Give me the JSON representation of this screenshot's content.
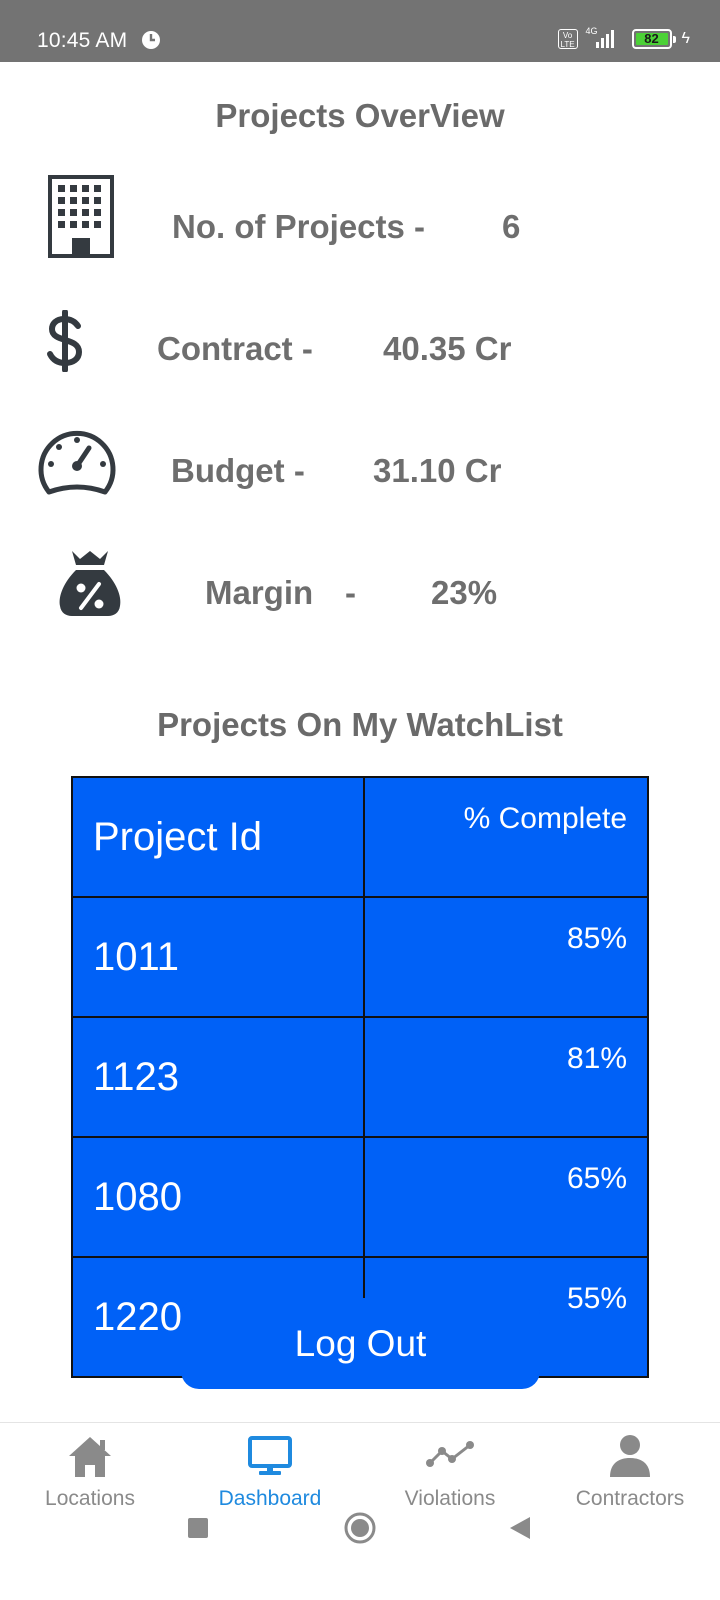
{
  "status_bar": {
    "time": "10:45 AM",
    "volte": "Vo LTE",
    "network": "4G",
    "battery": "82"
  },
  "overview": {
    "title": "Projects OverView",
    "rows": [
      {
        "label": "No. of Projects -",
        "value": "6",
        "icon": "building-icon"
      },
      {
        "label": "Contract -",
        "value": "40.35 Cr",
        "icon": "dollar-icon"
      },
      {
        "label": "Budget -",
        "value": "31.10 Cr",
        "icon": "speedometer-icon"
      },
      {
        "label": "Margin",
        "dash": "-",
        "value": "23%",
        "icon": "money-bag-percent-icon"
      }
    ]
  },
  "watchlist": {
    "title": "Projects On My WatchList",
    "header": {
      "project_id": "Project Id",
      "complete": "% Complete"
    },
    "rows": [
      {
        "id": "1011",
        "complete": "85%"
      },
      {
        "id": "1123",
        "complete": "81%"
      },
      {
        "id": "1080",
        "complete": "65%"
      },
      {
        "id": "1220",
        "complete": "55%"
      }
    ]
  },
  "logout_label": "Log Out",
  "bottom_nav": [
    {
      "label": "Locations",
      "icon": "home-icon",
      "active": false
    },
    {
      "label": "Dashboard",
      "icon": "monitor-icon",
      "active": true
    },
    {
      "label": "Violations",
      "icon": "line-chart-icon",
      "active": false
    },
    {
      "label": "Contractors",
      "icon": "person-icon",
      "active": false
    }
  ],
  "colors": {
    "accent": "#0061f7",
    "status_bar": "#737373",
    "active_nav": "#1f8adf",
    "text_gray": "#6e6e6e"
  }
}
